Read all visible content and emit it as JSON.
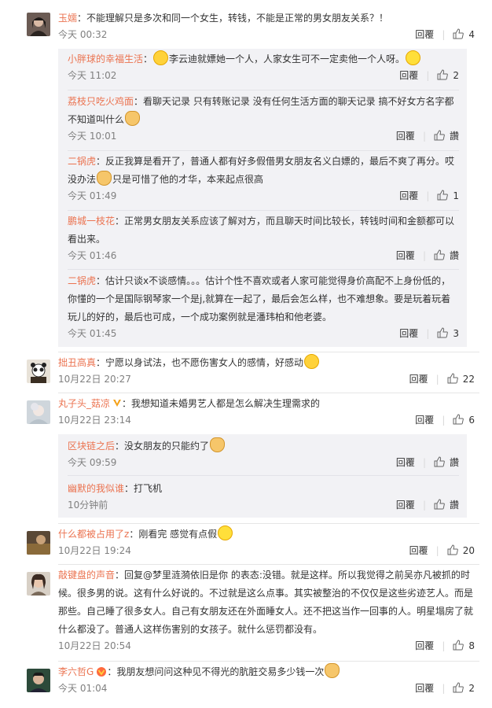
{
  "like_icon": "thumbs-up-icon",
  "reply_label": "回覆",
  "like_empty_label": "讚",
  "comments": [
    {
      "user": "玉嬬",
      "text": "：不能理解只是多次和同一个女生，转钱，不能是正常的男女朋友关系？！",
      "time": "今天 00:32",
      "likes": "4",
      "replies": [
        {
          "user": "小胖球的幸福生活",
          "text_a": "：",
          "text_b": "李云迪就嫖她一个人，人家女生可不一定卖他一个人呀。",
          "time": "今天 11:02",
          "likes": "2"
        },
        {
          "user": "荔枝只吃火鸡面",
          "text_a": "：看聊天记录  只有转账记录  没有任何生活方面的聊天记录  搞不好女方名字都不知道叫什么",
          "time": "今天 10:01",
          "likes": "讚"
        },
        {
          "user": "二锅虎",
          "text_a": "：反正我算是看开了，普通人都有好多假借男女朋友名义白嫖的，最后不爽了再分。哎没办法",
          "text_b": "只是可惜了他的才华，本来起点很高",
          "time": "今天 01:49",
          "likes": "1"
        },
        {
          "user": "鹏城一枝花",
          "text_a": "：正常男女朋友关系应该了解对方，而且聊天时间比较长，转钱时间和金额都可以看出来。",
          "time": "今天 01:46",
          "likes": "讚"
        },
        {
          "user": "二锅虎",
          "text_a": "：估计只谈x不谈感情。。。估计个性不喜欢或者人家可能觉得身价高配不上身份低的，你懂的一个是国际钢琴家一个是j,就算在一起了，最后会怎么样，也不难想象。要是玩着玩着玩儿的好的，最后也可成，一个成功案例就是潘玮柏和他老婆。",
          "time": "今天 01:45",
          "likes": "3"
        }
      ]
    },
    {
      "user": "拙丑高真",
      "text": "：宁愿以身试法，也不愿伤害女人的感情，好感动",
      "time": "10月22日 20:27",
      "likes": "22"
    },
    {
      "user": "丸子头_菇凉",
      "text": "：我想知道未婚男艺人都是怎么解决生理需求的",
      "time": "10月22日 23:14",
      "likes": "6",
      "replies": [
        {
          "user": "区块链之后",
          "text_a": "：没女朋友的只能约了",
          "time": "今天 09:59",
          "likes": "讚"
        },
        {
          "user": "幽默的我似谁",
          "text_a": "：打飞机",
          "time": "10分钟前",
          "likes": "讚"
        }
      ]
    },
    {
      "user": "什么都被占用了z",
      "text": "：刚看完 感觉有点假",
      "time": "10月22日 19:24",
      "likes": "20"
    },
    {
      "user": "敲键盘的声音",
      "text": "：回复@梦里涟漪依旧是你 的表态:没错。就是这样。所以我觉得之前吴亦凡被抓的时候。很多男的说。这有什么好说的。不过就是这么点事。其实被整治的不仅仅是这些劣迹艺人。而是那些。自己睡了很多女人。自己有女朋友还在外面睡女人。还不把这当作一回事的人。明星塌房了就什么都没了。普通人这样伤害别的女孩子。就什么惩罚都没有。",
      "time": "10月22日 20:54",
      "likes": "8"
    },
    {
      "user": "李六哲G",
      "text": "：我朋友想问问这种见不得光的肮脏交易多少钱一次",
      "time": "今天 01:04",
      "likes": "2"
    }
  ]
}
